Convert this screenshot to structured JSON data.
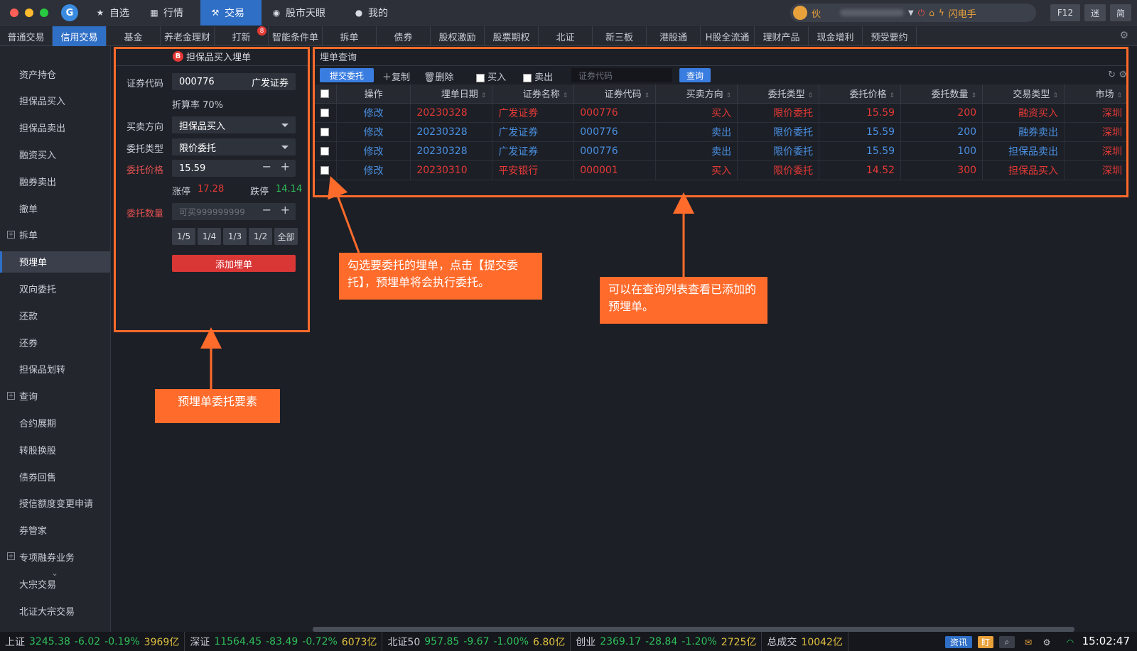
{
  "titlebar": {
    "nav": [
      {
        "icon": "star-icon",
        "label": "自选"
      },
      {
        "icon": "chart-icon",
        "label": "行情"
      },
      {
        "icon": "hammer-icon",
        "label": "交易",
        "active": true
      },
      {
        "icon": "eye-icon",
        "label": "股市天眼"
      },
      {
        "icon": "user-icon",
        "label": "我的"
      }
    ],
    "user_initial": "伙",
    "flash": "闪电手",
    "f12": "F12",
    "mini": "迷",
    "simple": "简"
  },
  "tabs": [
    {
      "label": "普通交易"
    },
    {
      "label": "信用交易",
      "active": true
    },
    {
      "label": "基金"
    },
    {
      "label": "养老金理财"
    },
    {
      "label": "打新",
      "badge": "8"
    },
    {
      "label": "智能条件单"
    },
    {
      "label": "拆单"
    },
    {
      "label": "债券"
    },
    {
      "label": "股权激励"
    },
    {
      "label": "股票期权"
    },
    {
      "label": "北证"
    },
    {
      "label": "新三板"
    },
    {
      "label": "港股通"
    },
    {
      "label": "H股全流通"
    },
    {
      "label": "理财产品"
    },
    {
      "label": "现金增利"
    },
    {
      "label": "预受要约"
    }
  ],
  "sidebar": [
    {
      "label": "资产持仓"
    },
    {
      "label": "担保品买入"
    },
    {
      "label": "担保品卖出"
    },
    {
      "label": "融资买入"
    },
    {
      "label": "融券卖出"
    },
    {
      "label": "撤单"
    },
    {
      "label": "拆单",
      "expand": true
    },
    {
      "label": "预埋单",
      "active": true
    },
    {
      "label": "双向委托"
    },
    {
      "label": "还款"
    },
    {
      "label": "还券"
    },
    {
      "label": "担保品划转"
    },
    {
      "label": "查询",
      "expand": true
    },
    {
      "label": "合约展期"
    },
    {
      "label": "转股换股"
    },
    {
      "label": "债券回售"
    },
    {
      "label": "授信额度变更申请"
    },
    {
      "label": "券管家"
    },
    {
      "label": "专项融券业务",
      "expand": true
    },
    {
      "label": "大宗交易"
    },
    {
      "label": "北证大宗交易"
    }
  ],
  "form": {
    "title": "担保品买入埋单",
    "b_badge": "B",
    "code_label": "证券代码",
    "code": "000776",
    "name": "广发证券",
    "rate": "折算率 70%",
    "dir_label": "买卖方向",
    "dir": "担保品买入",
    "type_label": "委托类型",
    "type": "限价委托",
    "price_label": "委托价格",
    "price": "15.59",
    "zt_label": "涨停",
    "zt": "17.28",
    "dt_label": "跌停",
    "dt": "14.14",
    "qty_label": "委托数量",
    "qty_placeholder": "可买999999999",
    "fractions": [
      "1/5",
      "1/4",
      "1/3",
      "1/2",
      "全部"
    ],
    "add": "添加埋单"
  },
  "query": {
    "title": "埋单查询",
    "submit": "提交委托",
    "copy": "复制",
    "delete": "删除",
    "buy": "买入",
    "sell": "卖出",
    "search_placeholder": "证券代码",
    "search_btn": "查询",
    "columns": [
      "操作",
      "埋单日期",
      "证券名称",
      "证券代码",
      "买卖方向",
      "委托类型",
      "委托价格",
      "委托数量",
      "交易类型",
      "市场"
    ],
    "rows": [
      {
        "op": "修改",
        "date": "20230328",
        "name": "广发证券",
        "code": "000776",
        "dir": "买入",
        "type": "限价委托",
        "price": "15.59",
        "qty": "200",
        "ttype": "融资买入",
        "market": "深圳",
        "color": "red"
      },
      {
        "op": "修改",
        "date": "20230328",
        "name": "广发证券",
        "code": "000776",
        "dir": "卖出",
        "type": "限价委托",
        "price": "15.59",
        "qty": "200",
        "ttype": "融券卖出",
        "market": "深圳",
        "color": "blue"
      },
      {
        "op": "修改",
        "date": "20230328",
        "name": "广发证券",
        "code": "000776",
        "dir": "卖出",
        "type": "限价委托",
        "price": "15.59",
        "qty": "100",
        "ttype": "担保品卖出",
        "market": "深圳",
        "color": "blue"
      },
      {
        "op": "修改",
        "date": "20230310",
        "name": "平安银行",
        "code": "000001",
        "dir": "买入",
        "type": "限价委托",
        "price": "14.52",
        "qty": "300",
        "ttype": "担保品买入",
        "market": "深圳",
        "color": "red"
      }
    ]
  },
  "callouts": {
    "left": "预埋单委托要素",
    "mid": "勾选要委托的埋单，点击【提交委托】，预埋单将会执行委托。",
    "right": "可以在查询列表查看已添加的预埋单。"
  },
  "status": [
    {
      "name": "上证",
      "val": "3245.38",
      "chg": "-6.02",
      "pct": "-0.19%",
      "amt": "3969亿"
    },
    {
      "name": "深证",
      "val": "11564.45",
      "chg": "-83.49",
      "pct": "-0.72%",
      "amt": "6073亿"
    },
    {
      "name": "北证50",
      "val": "957.85",
      "chg": "-9.67",
      "pct": "-1.00%",
      "amt": "6.80亿"
    },
    {
      "name": "创业",
      "val": "2369.17",
      "chg": "-28.84",
      "pct": "-1.20%",
      "amt": "2725亿"
    }
  ],
  "total_label": "总成交",
  "total": "10042亿",
  "news": "资讯",
  "ding": "盯",
  "clock": "15:02:47",
  "colors": {
    "accent": "#2f6fc6",
    "highlight": "#ff6b2b",
    "up": "#e53935",
    "down": "#2fbf5a"
  }
}
